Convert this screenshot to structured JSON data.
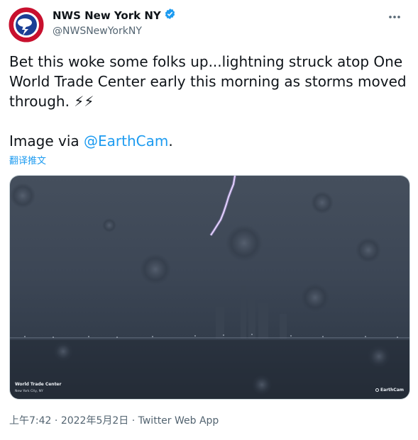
{
  "user": {
    "display_name": "NWS New York NY",
    "handle": "@NWSNewYorkNY",
    "avatar_icon": "nws-logo-icon",
    "verified": true
  },
  "tweet": {
    "line1": "Bet this woke some folks up...lightning struck atop One",
    "line2": "World Trade Center early this morning as storms moved",
    "line3": "through. ⚡⚡",
    "line4_prefix": "Image via ",
    "line4_link": "@EarthCam",
    "line4_suffix": ".",
    "translate_label": "翻译推文"
  },
  "media": {
    "caption_title": "World Trade Center",
    "caption_subtitle": "New York City, NY",
    "watermark": "EarthCam"
  },
  "meta": {
    "time": "上午7:42",
    "separator": "·",
    "date": "2022年5月2日",
    "source": "Twitter Web App"
  },
  "colors": {
    "link": "#1d9bf0",
    "secondary_text": "#536471",
    "verified_badge": "#1d9bf0"
  }
}
